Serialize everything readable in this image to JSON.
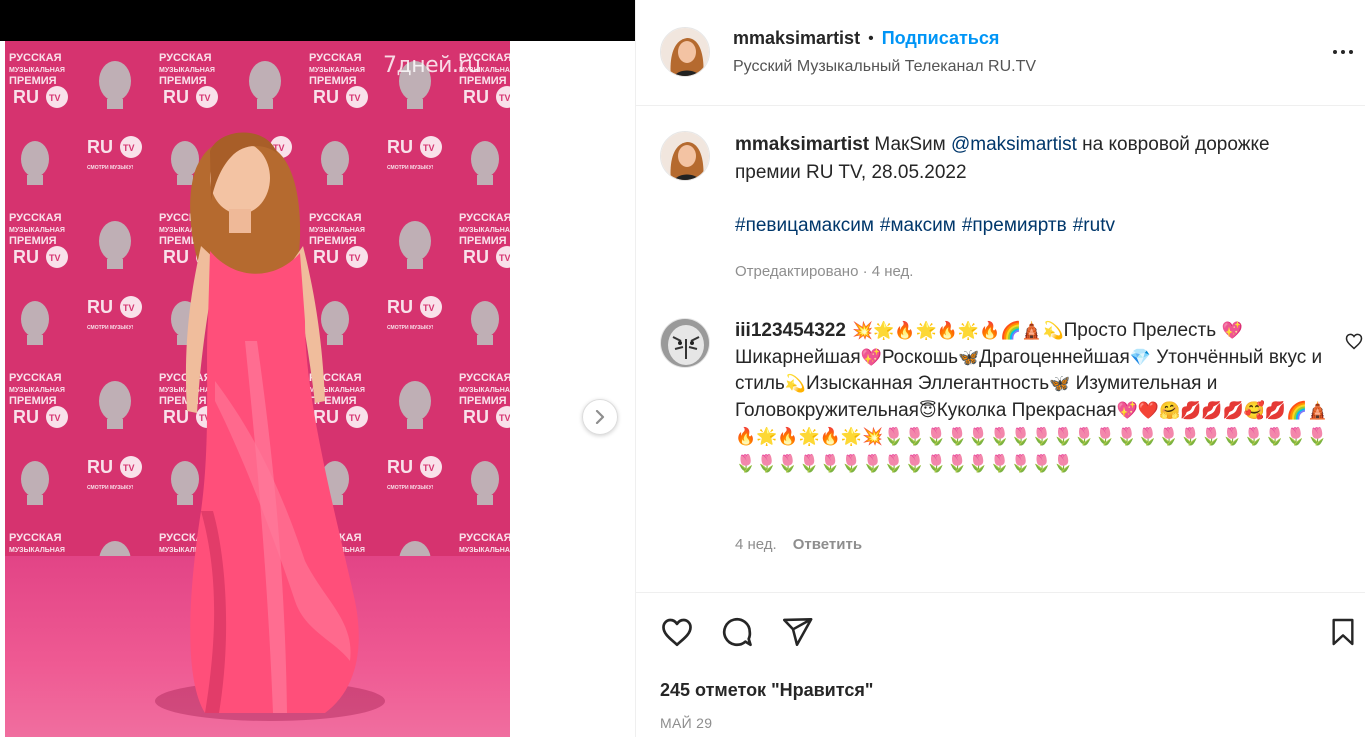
{
  "media": {
    "watermark": "7дней.ru",
    "backdrop_text_line1": "РУССКАЯ",
    "backdrop_text_line2": "МУЗЫКАЛЬНАЯ",
    "backdrop_text_line3": "ПРЕМИЯ",
    "backdrop_logo": "RU TV",
    "backdrop_slogan": "СМОТРИ МУЗЫКУ!",
    "colors": {
      "backdrop": "#d6336f",
      "dress": "#ff4f7a",
      "hair": "#b56a2f"
    }
  },
  "header": {
    "username": "mmaksimartist",
    "separator": "•",
    "follow_label": "Подписаться",
    "location": "Русский Музыкальный Телеканал RU.TV"
  },
  "caption": {
    "author": "mmaksimartist",
    "text_before_mention": "МакSим",
    "mention": "@maksimartist",
    "text_after_mention": "на ковровой дорожке премии RU TV, 28.05.2022",
    "hashtags": [
      "#певицамаксим",
      "#максим",
      "#премияртв",
      "#rutv"
    ],
    "meta": "Отредактировано · 4 нед."
  },
  "comment": {
    "author": "iii123454322",
    "emoji_start": "💥🌟🔥🌟🔥🌟🔥🌈🛕💫",
    "text1": "Просто Прелесть",
    "emoji_heart1": "💖",
    "text2": "Шикарнейшая",
    "emoji_heart2": "💖",
    "text3": "Роскошь",
    "emoji_butterfly1": "🦋",
    "text4": "Драгоценнейшая",
    "emoji_gem": "💎",
    "text5": "Утончённый вкус и стиль",
    "emoji_dizzy": "💫",
    "text6": "Изысканная Эллегантность",
    "emoji_butterfly2": "🦋",
    "text7": "Изумительная и Головокружительная",
    "emoji_angel": "😇",
    "text8": "Куколка Прекрасная",
    "emoji_tail": "💖❤️🤗💋💋💋🥰💋🌈🛕🔥🌟🔥🌟🔥🌟💥🌷🌷🌷🌷🌷🌷🌷🌷🌷🌷🌷🌷🌷🌷🌷🌷🌷🌷🌷🌷🌷🌷🌷🌷🌷🌷🌷🌷🌷🌷🌷🌷🌷🌷🌷🌷🌷",
    "time": "4 нед.",
    "reply_label": "Ответить"
  },
  "actions": {
    "likes_text": "245 отметок \"Нравится\"",
    "date": "МАЙ 29"
  }
}
